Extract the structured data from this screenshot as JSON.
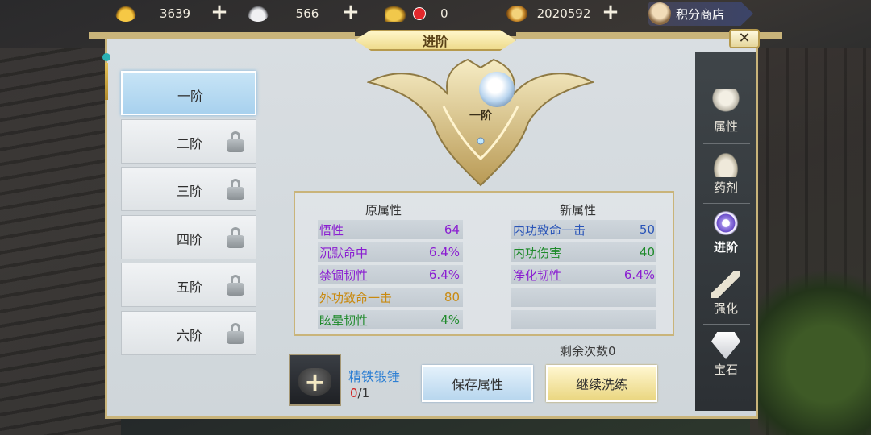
{
  "resources": {
    "gold": "3639",
    "silver": "566",
    "tokens": "0",
    "copper": "2020592"
  },
  "shop_label": "积分商店",
  "dialog": {
    "title": "进阶",
    "close": "✕"
  },
  "tiers": [
    {
      "label": "一阶",
      "locked": false,
      "active": true
    },
    {
      "label": "二阶",
      "locked": true
    },
    {
      "label": "三阶",
      "locked": true
    },
    {
      "label": "四阶",
      "locked": true
    },
    {
      "label": "五阶",
      "locked": true
    },
    {
      "label": "六阶",
      "locked": true
    }
  ],
  "emblem_label": "一阶",
  "attributes": {
    "original_header": "原属性",
    "new_header": "新属性",
    "original": [
      {
        "name": "悟性",
        "value": "64"
      },
      {
        "name": "沉默命中",
        "value": "6.4%"
      },
      {
        "name": "禁锢韧性",
        "value": "6.4%"
      },
      {
        "name": "外功致命一击",
        "value": "80"
      },
      {
        "name": "眩晕韧性",
        "value": "4%"
      }
    ],
    "new": [
      {
        "name": "内功致命一击",
        "value": "50"
      },
      {
        "name": "内功伤害",
        "value": "40"
      },
      {
        "name": "净化韧性",
        "value": "6.4%"
      },
      {
        "name": "",
        "value": ""
      },
      {
        "name": "",
        "value": ""
      }
    ]
  },
  "remaining": "剩余次数0",
  "item": {
    "name": "精铁锻锤",
    "have": "0",
    "need": "/1"
  },
  "buttons": {
    "save": "保存属性",
    "continue": "继续洗练"
  },
  "nav": [
    {
      "label": "属性",
      "icon": "person-icon"
    },
    {
      "label": "药剂",
      "icon": "gourd-icon"
    },
    {
      "label": "进阶",
      "icon": "swirl-icon",
      "active": true
    },
    {
      "label": "强化",
      "icon": "hammer-icon"
    },
    {
      "label": "宝石",
      "icon": "gem-icon"
    }
  ],
  "colors": {
    "purple": "#8a1dd1",
    "green": "#1e8a2a",
    "blue": "#2a55b8",
    "orange": "#c98a10",
    "gold_frame": "#c9b47a"
  }
}
